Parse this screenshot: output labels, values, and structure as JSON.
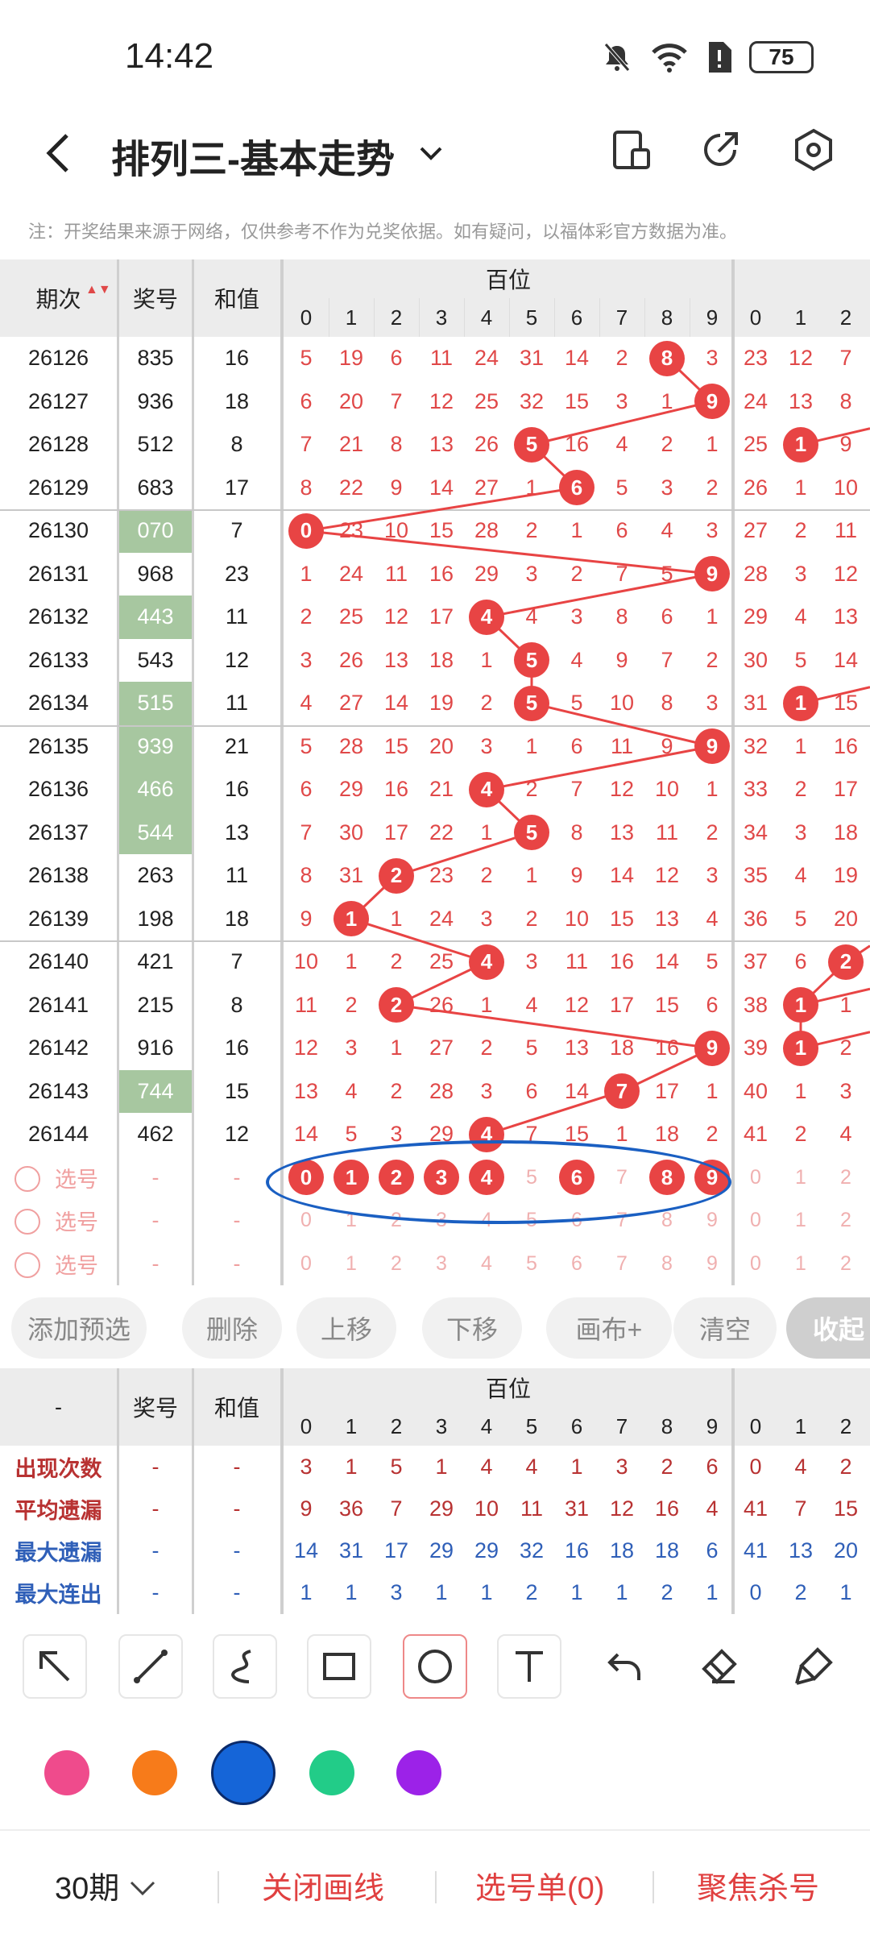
{
  "status": {
    "time": "14:42",
    "battery": "75"
  },
  "header": {
    "title": "排列三-基本走势"
  },
  "note": "注：开奖结果来源于网络，仅供参考不作为兑奖依据。如有疑问，以福体彩官方数据为准。",
  "table_header": {
    "period": "期次",
    "award": "奖号",
    "sum": "和值",
    "group": "百位",
    "digits": [
      "0",
      "1",
      "2",
      "3",
      "4",
      "5",
      "6",
      "7",
      "8",
      "9"
    ],
    "next_digits": [
      "0",
      "1",
      "2"
    ]
  },
  "rows": [
    {
      "p": "26126",
      "a": "835",
      "s": "16",
      "v": [
        "5",
        "19",
        "6",
        "11",
        "24",
        "31",
        "14",
        "2",
        "8",
        "3"
      ],
      "n": [
        "23",
        "12",
        "7"
      ],
      "g": false
    },
    {
      "p": "26127",
      "a": "936",
      "s": "18",
      "v": [
        "6",
        "20",
        "7",
        "12",
        "25",
        "32",
        "15",
        "3",
        "1",
        "9"
      ],
      "n": [
        "24",
        "13",
        "8"
      ],
      "g": false
    },
    {
      "p": "26128",
      "a": "512",
      "s": "8",
      "v": [
        "7",
        "21",
        "8",
        "13",
        "26",
        "5",
        "16",
        "4",
        "2",
        "1"
      ],
      "n": [
        "25",
        "1",
        "9"
      ],
      "g": false
    },
    {
      "p": "26129",
      "a": "683",
      "s": "17",
      "v": [
        "8",
        "22",
        "9",
        "14",
        "27",
        "1",
        "6",
        "5",
        "3",
        "2"
      ],
      "n": [
        "26",
        "1",
        "10"
      ],
      "g": false
    },
    {
      "p": "26130",
      "a": "070",
      "s": "7",
      "v": [
        "0",
        "23",
        "10",
        "15",
        "28",
        "2",
        "1",
        "6",
        "4",
        "3"
      ],
      "n": [
        "27",
        "2",
        "11"
      ],
      "g": true
    },
    {
      "p": "26131",
      "a": "968",
      "s": "23",
      "v": [
        "1",
        "24",
        "11",
        "16",
        "29",
        "3",
        "2",
        "7",
        "5",
        "9"
      ],
      "n": [
        "28",
        "3",
        "12"
      ],
      "g": false
    },
    {
      "p": "26132",
      "a": "443",
      "s": "11",
      "v": [
        "2",
        "25",
        "12",
        "17",
        "4",
        "4",
        "3",
        "8",
        "6",
        "1"
      ],
      "n": [
        "29",
        "4",
        "13"
      ],
      "g": true
    },
    {
      "p": "26133",
      "a": "543",
      "s": "12",
      "v": [
        "3",
        "26",
        "13",
        "18",
        "1",
        "5",
        "4",
        "9",
        "7",
        "2"
      ],
      "n": [
        "30",
        "5",
        "14"
      ],
      "g": false
    },
    {
      "p": "26134",
      "a": "515",
      "s": "11",
      "v": [
        "4",
        "27",
        "14",
        "19",
        "2",
        "5",
        "5",
        "10",
        "8",
        "3"
      ],
      "n": [
        "31",
        "1",
        "15"
      ],
      "g": true
    },
    {
      "p": "26135",
      "a": "939",
      "s": "21",
      "v": [
        "5",
        "28",
        "15",
        "20",
        "3",
        "1",
        "6",
        "11",
        "9",
        "9"
      ],
      "n": [
        "32",
        "1",
        "16"
      ],
      "g": true
    },
    {
      "p": "26136",
      "a": "466",
      "s": "16",
      "v": [
        "6",
        "29",
        "16",
        "21",
        "4",
        "2",
        "7",
        "12",
        "10",
        "1"
      ],
      "n": [
        "33",
        "2",
        "17"
      ],
      "g": true
    },
    {
      "p": "26137",
      "a": "544",
      "s": "13",
      "v": [
        "7",
        "30",
        "17",
        "22",
        "1",
        "5",
        "8",
        "13",
        "11",
        "2"
      ],
      "n": [
        "34",
        "3",
        "18"
      ],
      "g": true
    },
    {
      "p": "26138",
      "a": "263",
      "s": "11",
      "v": [
        "8",
        "31",
        "2",
        "23",
        "2",
        "1",
        "9",
        "14",
        "12",
        "3"
      ],
      "n": [
        "35",
        "4",
        "19"
      ],
      "g": false
    },
    {
      "p": "26139",
      "a": "198",
      "s": "18",
      "v": [
        "9",
        "1",
        "1",
        "24",
        "3",
        "2",
        "10",
        "15",
        "13",
        "4"
      ],
      "n": [
        "36",
        "5",
        "20"
      ],
      "g": false
    },
    {
      "p": "26140",
      "a": "421",
      "s": "7",
      "v": [
        "10",
        "1",
        "2",
        "25",
        "4",
        "3",
        "11",
        "16",
        "14",
        "5"
      ],
      "n": [
        "37",
        "6",
        "2"
      ],
      "g": false
    },
    {
      "p": "26141",
      "a": "215",
      "s": "8",
      "v": [
        "11",
        "2",
        "2",
        "26",
        "1",
        "4",
        "12",
        "17",
        "15",
        "6"
      ],
      "n": [
        "38",
        "1",
        "1"
      ],
      "g": false
    },
    {
      "p": "26142",
      "a": "916",
      "s": "16",
      "v": [
        "12",
        "3",
        "1",
        "27",
        "2",
        "5",
        "13",
        "18",
        "16",
        "9"
      ],
      "n": [
        "39",
        "1",
        "2"
      ],
      "g": false
    },
    {
      "p": "26143",
      "a": "744",
      "s": "15",
      "v": [
        "13",
        "4",
        "2",
        "28",
        "3",
        "6",
        "14",
        "7",
        "17",
        "1"
      ],
      "n": [
        "40",
        "1",
        "3"
      ],
      "g": true
    },
    {
      "p": "26144",
      "a": "462",
      "s": "12",
      "v": [
        "14",
        "5",
        "3",
        "29",
        "4",
        "7",
        "15",
        "1",
        "18",
        "2"
      ],
      "n": [
        "41",
        "2",
        "4"
      ],
      "g": false
    }
  ],
  "hits": [
    8,
    9,
    5,
    6,
    0,
    9,
    4,
    5,
    5,
    9,
    4,
    5,
    2,
    1,
    4,
    2,
    9,
    7,
    4
  ],
  "next_hits": [
    null,
    null,
    1,
    null,
    null,
    null,
    null,
    null,
    1,
    null,
    null,
    null,
    null,
    null,
    2,
    1,
    1,
    null,
    null
  ],
  "select_rows": [
    {
      "label": "选号",
      "dash1": "-",
      "dash2": "-"
    },
    {
      "label": "选号",
      "dash1": "-",
      "dash2": "-"
    },
    {
      "label": "选号",
      "dash1": "-",
      "dash2": "-"
    }
  ],
  "select_selected": [
    true,
    true,
    true,
    true,
    true,
    false,
    true,
    false,
    true,
    true
  ],
  "buttons": [
    "添加预选",
    "删除",
    "上移",
    "下移",
    "画布+",
    "清空",
    "收起"
  ],
  "stats_header": {
    "dash": "-",
    "award": "奖号",
    "sum": "和值",
    "group": "百位"
  },
  "stats": [
    {
      "label": "出现次数",
      "color": "#b83232",
      "v": [
        "3",
        "1",
        "5",
        "1",
        "4",
        "4",
        "1",
        "3",
        "2",
        "6"
      ],
      "n": [
        "0",
        "4",
        "2"
      ]
    },
    {
      "label": "平均遗漏",
      "color": "#b83232",
      "v": [
        "9",
        "36",
        "7",
        "29",
        "10",
        "11",
        "31",
        "12",
        "16",
        "4"
      ],
      "n": [
        "41",
        "7",
        "15"
      ]
    },
    {
      "label": "最大遗漏",
      "color": "#2f5fb8",
      "v": [
        "14",
        "31",
        "17",
        "29",
        "29",
        "32",
        "16",
        "18",
        "18",
        "6"
      ],
      "n": [
        "41",
        "13",
        "20"
      ]
    },
    {
      "label": "最大连出",
      "color": "#2f5fb8",
      "v": [
        "1",
        "1",
        "3",
        "1",
        "1",
        "2",
        "1",
        "1",
        "2",
        "1"
      ],
      "n": [
        "0",
        "2",
        "1"
      ]
    }
  ],
  "palette": [
    "#ef4b8c",
    "#f77b1a",
    "#1565d8",
    "#22cc88",
    "#9c22e8"
  ],
  "bottom": {
    "period": "30期",
    "close": "关闭画线",
    "list": "选号单(0)",
    "focus": "聚焦杀号"
  }
}
